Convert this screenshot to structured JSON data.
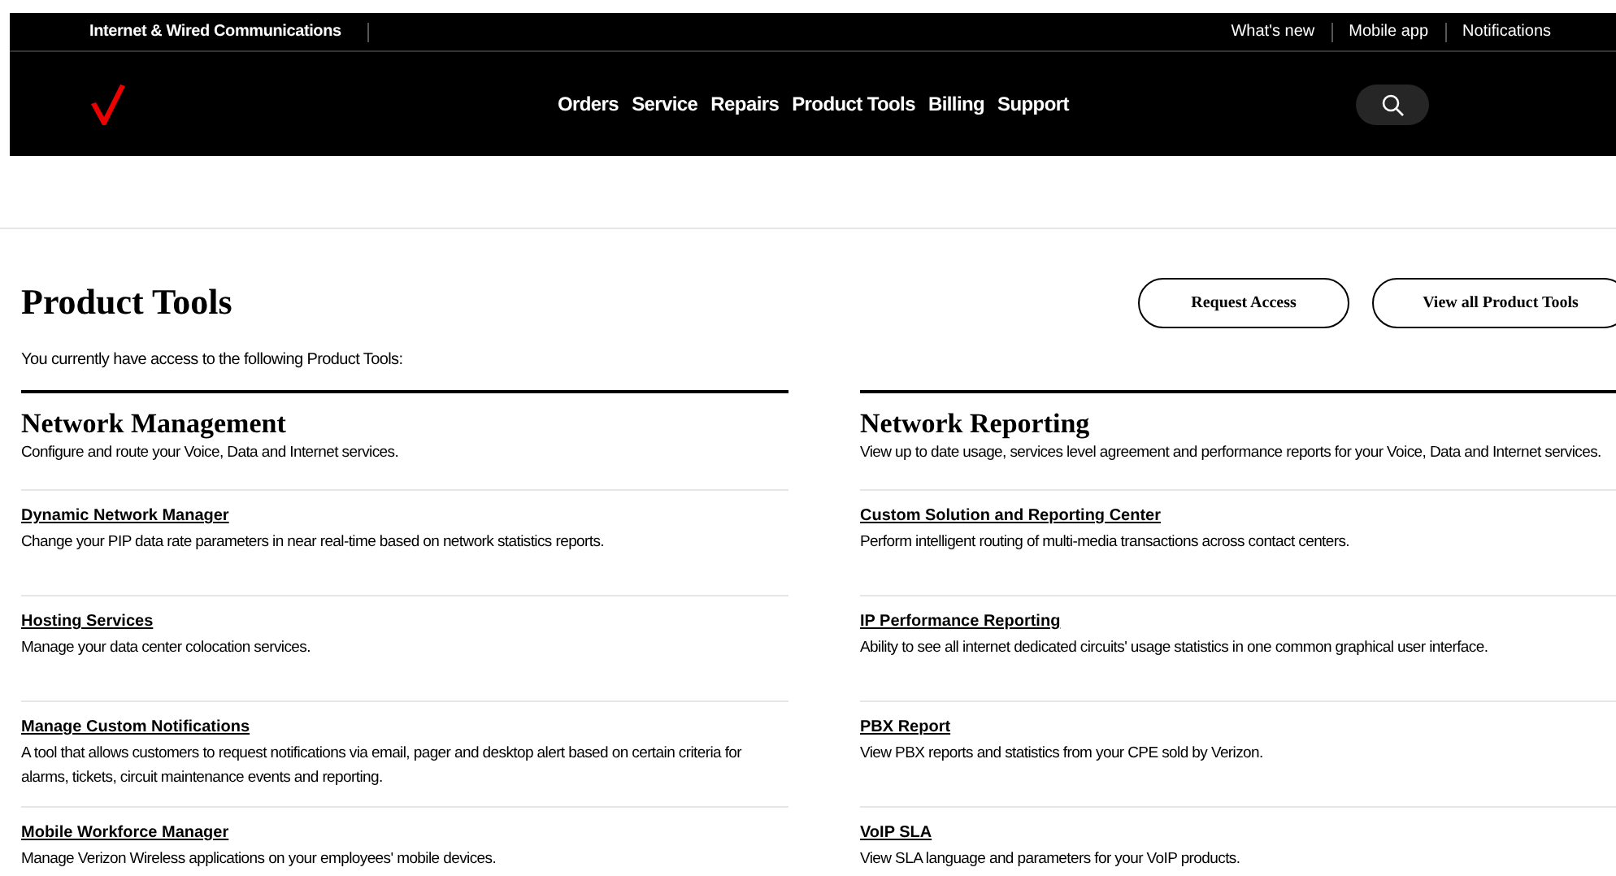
{
  "top_bar": {
    "brand_text": "Internet & Wired Communications",
    "links": [
      "What's new",
      "Mobile app",
      "Notifications"
    ]
  },
  "nav": {
    "items": [
      "Orders",
      "Service",
      "Repairs",
      "Product Tools",
      "Billing",
      "Support"
    ]
  },
  "page": {
    "title": "Product Tools",
    "subtitle": "You currently have access to the following Product Tools:",
    "buttons": [
      "Request Access",
      "View all Product Tools"
    ]
  },
  "sections": [
    {
      "title": "Network Management",
      "description": "Configure and route your Voice, Data and Internet services.",
      "tools": [
        {
          "name": "Dynamic Network Manager",
          "description": "Change your PIP data rate parameters in near real-time based on network statistics reports."
        },
        {
          "name": "Hosting Services",
          "description": "Manage your data center colocation services."
        },
        {
          "name": "Manage Custom Notifications",
          "description": "A tool that allows customers to request notifications via email, pager and desktop alert based on certain criteria for alarms, tickets, circuit maintenance events and reporting."
        },
        {
          "name": "Mobile Workforce Manager",
          "description": "Manage Verizon Wireless applications on your employees' mobile devices."
        }
      ]
    },
    {
      "title": "Network Reporting",
      "description": "View up to date usage, services level agreement and performance reports for your Voice, Data and Internet services.",
      "tools": [
        {
          "name": "Custom Solution and Reporting Center",
          "description": "Perform intelligent routing of multi-media transactions across contact centers."
        },
        {
          "name": "IP Performance Reporting",
          "description": "Ability to see all internet dedicated circuits' usage statistics in one common graphical user interface."
        },
        {
          "name": "PBX Report",
          "description": "View PBX reports and statistics from your CPE sold by Verizon."
        },
        {
          "name": "VoIP SLA",
          "description": "View SLA language and parameters for your VoIP products."
        }
      ]
    }
  ]
}
